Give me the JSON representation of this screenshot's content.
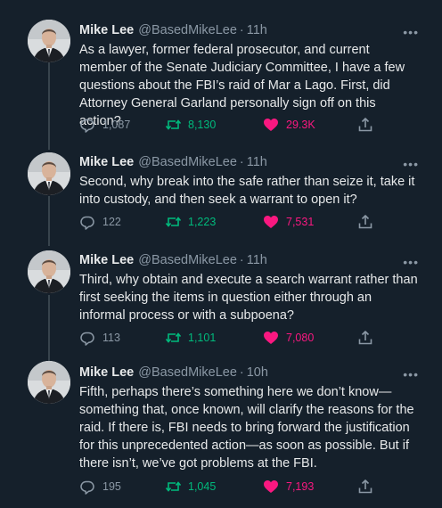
{
  "colors": {
    "background": "#15202b",
    "text": "#e7e9ea",
    "muted": "#8b98a5",
    "retweet_active": "#00ba7c",
    "like_active": "#f91880"
  },
  "icons": [
    "avatar",
    "more-icon",
    "reply-icon",
    "retweet-icon",
    "like-icon",
    "share-icon"
  ],
  "tweets": [
    {
      "name": "Mike Lee",
      "handle": "@BasedMikeLee",
      "dot": "·",
      "time": "11h",
      "more": "•••",
      "text": "As a lawyer, former federal prosecutor, and current member of the Senate Judiciary Committee, I have a few questions about the FBI’s raid of Mar a Lago.  First, did Attorney General Garland personally sign off on this action?",
      "replies": "1,087",
      "retweets": "8,130",
      "likes": "29.3K"
    },
    {
      "name": "Mike Lee",
      "handle": "@BasedMikeLee",
      "dot": "·",
      "time": "11h",
      "more": "•••",
      "text": "Second, why break into the safe rather than seize it, take it into custody, and then seek a warrant to open it?",
      "replies": "122",
      "retweets": "1,223",
      "likes": "7,531"
    },
    {
      "name": "Mike Lee",
      "handle": "@BasedMikeLee",
      "dot": "·",
      "time": "11h",
      "more": "•••",
      "text": "Third, why obtain and execute a search warrant rather than first seeking the items in question either through an informal process or with a subpoena?",
      "replies": "113",
      "retweets": "1,101",
      "likes": "7,080"
    },
    {
      "name": "Mike Lee",
      "handle": "@BasedMikeLee",
      "dot": "·",
      "time": "10h",
      "more": "•••",
      "text": "Fifth, perhaps there’s something here we don’t know—something that, once known, will clarify the reasons for the raid.  If there is, FBI needs to bring forward the justification for this unprecedented action—as soon as possible.  But if there isn’t, we’ve got problems at the FBI.",
      "replies": "195",
      "retweets": "1,045",
      "likes": "7,193"
    }
  ]
}
